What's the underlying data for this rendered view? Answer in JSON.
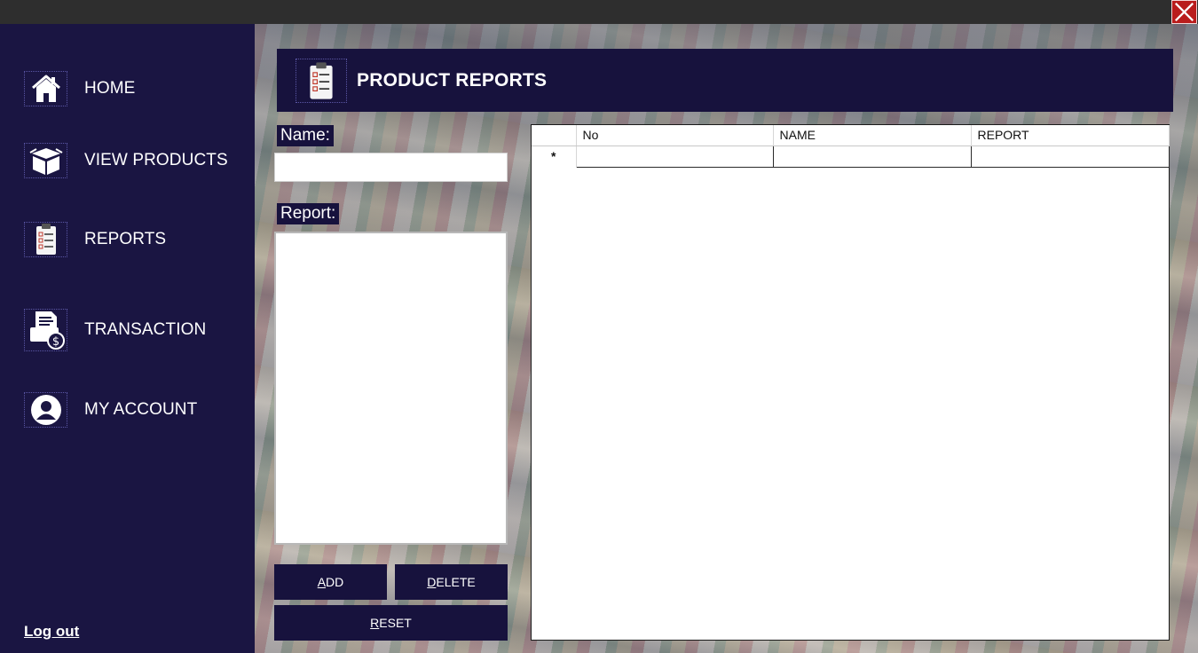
{
  "sidebar": {
    "items": [
      {
        "label": "HOME",
        "icon": "home-icon"
      },
      {
        "label": "VIEW PRODUCTS",
        "icon": "box-icon"
      },
      {
        "label": "REPORTS",
        "icon": "clipboard-icon"
      },
      {
        "label": "TRANSACTION",
        "icon": "transaction-icon"
      },
      {
        "label": "MY ACCOUNT",
        "icon": "user-icon"
      }
    ],
    "logout_label": "Log out"
  },
  "header": {
    "title": "PRODUCT REPORTS",
    "icon": "clipboard-icon"
  },
  "form": {
    "name_label": "Name:",
    "name_value": "",
    "report_label": "Report:",
    "report_value": ""
  },
  "buttons": {
    "add": {
      "prefix": "",
      "mnemonic": "A",
      "rest": "DD"
    },
    "delete": {
      "prefix": "",
      "mnemonic": "D",
      "rest": "ELETE"
    },
    "reset": {
      "prefix": "",
      "mnemonic": "R",
      "rest": "ESET"
    }
  },
  "grid": {
    "columns": [
      "No",
      "NAME",
      "REPORT"
    ],
    "new_row_marker": "*",
    "rows": []
  },
  "colors": {
    "sidebar_bg": "#1a1542",
    "accent_navy": "#17123d",
    "close_red": "#b91c1c"
  }
}
